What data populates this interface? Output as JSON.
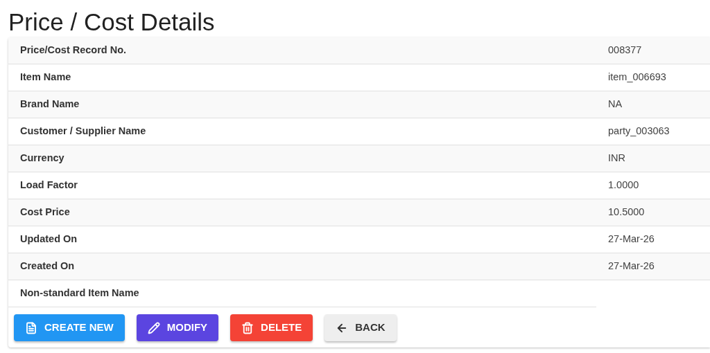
{
  "title": "Price / Cost Details",
  "rows": [
    {
      "label": "Price/Cost Record No.",
      "value": "008377"
    },
    {
      "label": "Item Name",
      "value": "item_006693"
    },
    {
      "label": "Brand Name",
      "value": "NA"
    },
    {
      "label": "Customer / Supplier Name",
      "value": "party_003063"
    },
    {
      "label": "Currency",
      "value": "INR"
    },
    {
      "label": "Load Factor",
      "value": "1.0000"
    },
    {
      "label": "Cost Price",
      "value": "10.5000"
    },
    {
      "label": "Updated On",
      "value": "27-Mar-26"
    },
    {
      "label": "Created On",
      "value": "27-Mar-26"
    },
    {
      "label": "Non-standard Item Name"
    }
  ],
  "buttons": [
    {
      "kind": "create",
      "label": "CREATE NEW"
    },
    {
      "kind": "modify",
      "label": "MODIFY"
    },
    {
      "kind": "delete",
      "label": "DELETE"
    },
    {
      "kind": "back",
      "label": "BACK"
    }
  ]
}
